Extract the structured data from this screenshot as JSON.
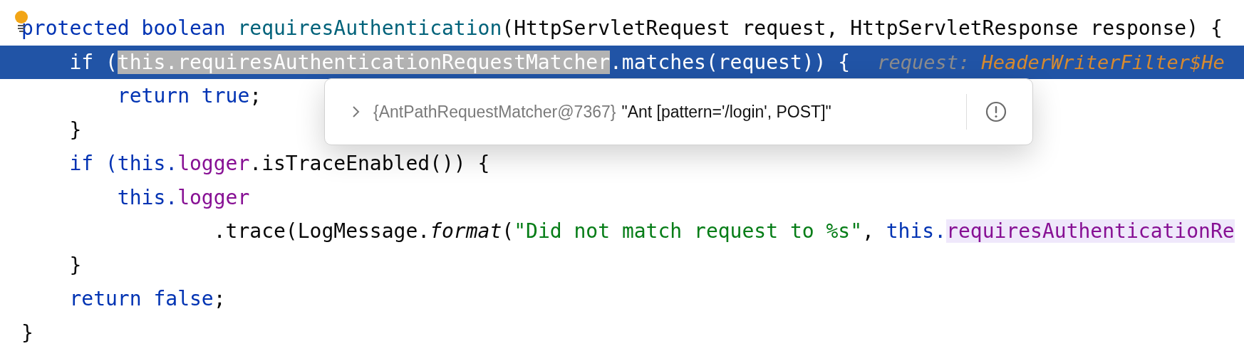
{
  "editor": {
    "lines": [
      {
        "kind": "signature",
        "current": false,
        "tokens": [
          {
            "text": "protected boolean ",
            "kind": "keyword"
          },
          {
            "text": "requiresAuthentication",
            "kind": "declaration"
          },
          {
            "text": "(HttpServletRequest request, HttpServletResponse response) {",
            "kind": "plain"
          }
        ]
      },
      {
        "kind": "body",
        "current": true,
        "tokens": [
          {
            "text": "if (",
            "kind": "plain"
          },
          {
            "text": "this.requiresAuthenticationRequestMatcher",
            "kind": "selection"
          },
          {
            "text": ".matches(request)) {",
            "kind": "plain"
          }
        ],
        "hint": {
          "label": "request: ",
          "value": "HeaderWriterFilter$He"
        }
      },
      {
        "kind": "nested",
        "current": false,
        "tokens": [
          {
            "text": "return true",
            "kind": "keyword"
          },
          {
            "text": ";",
            "kind": "plain"
          }
        ]
      },
      {
        "kind": "body",
        "current": false,
        "tokens": [
          {
            "text": "}",
            "kind": "plain"
          }
        ]
      },
      {
        "kind": "body",
        "current": false,
        "tokens": [
          {
            "text": "if (this.",
            "kind": "keyword"
          },
          {
            "text": "logger",
            "kind": "field"
          },
          {
            "text": ".isTraceEnabled()) {",
            "kind": "plain"
          }
        ]
      },
      {
        "kind": "nested",
        "current": false,
        "tokens": [
          {
            "text": "this.",
            "kind": "keyword"
          },
          {
            "text": "logger",
            "kind": "field"
          }
        ]
      },
      {
        "kind": "continuation",
        "current": false,
        "tokens": [
          {
            "text": ".trace(LogMessage.",
            "kind": "plain"
          },
          {
            "text": "format",
            "kind": "static"
          },
          {
            "text": "(",
            "kind": "plain"
          },
          {
            "text": "\"Did not match request to %s\"",
            "kind": "string"
          },
          {
            "text": ", ",
            "kind": "plain"
          },
          {
            "text": "this.",
            "kind": "keyword"
          },
          {
            "text": "requiresAuthenticationRe",
            "kind": "usage"
          }
        ]
      },
      {
        "kind": "body",
        "current": false,
        "tokens": [
          {
            "text": "}",
            "kind": "plain"
          }
        ]
      },
      {
        "kind": "body",
        "current": false,
        "tokens": [
          {
            "text": "return false",
            "kind": "keyword"
          },
          {
            "text": ";",
            "kind": "plain"
          }
        ]
      },
      {
        "kind": "signature",
        "current": false,
        "tokens": [
          {
            "text": "}",
            "kind": "plain"
          }
        ]
      }
    ]
  },
  "popup": {
    "expanded": false,
    "object_id": "{AntPathRequestMatcher@7367}",
    "value": "\"Ant [pattern='/login', POST]\""
  }
}
